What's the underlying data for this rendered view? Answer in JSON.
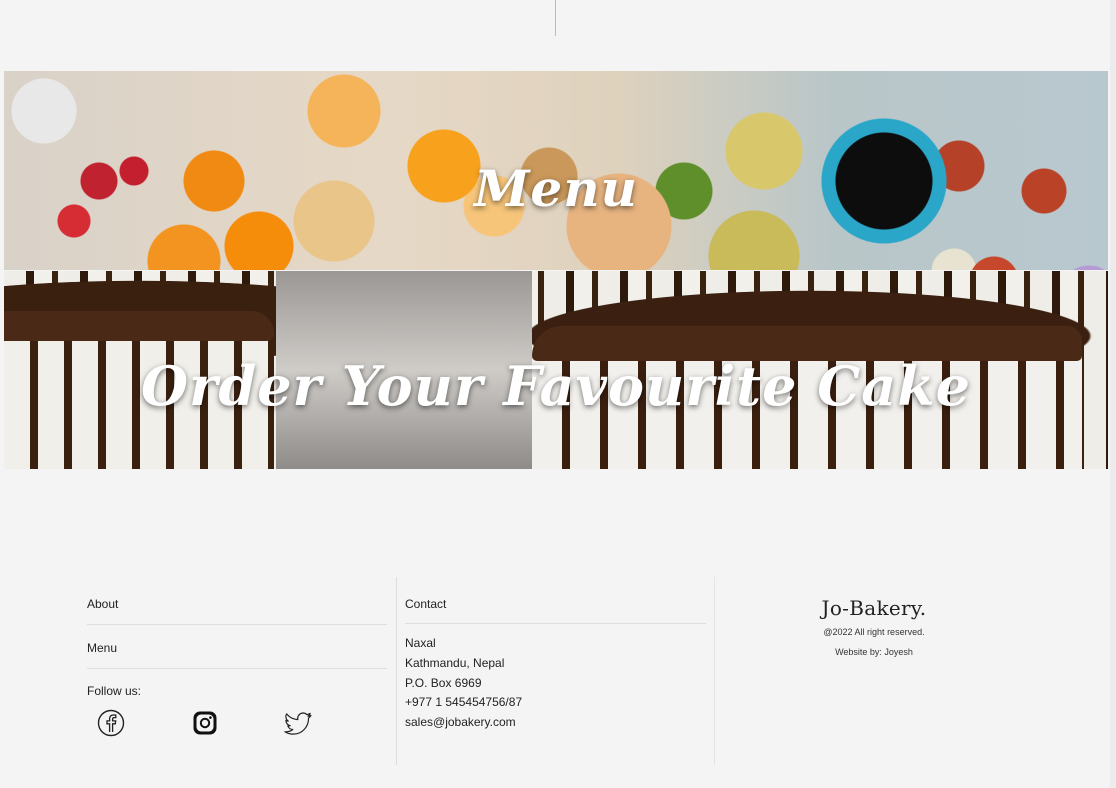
{
  "banners": {
    "menu_title": "Menu",
    "order_title": "Order Your Favourite Cake"
  },
  "footer": {
    "links": [
      {
        "label": "About"
      },
      {
        "label": "Menu"
      }
    ],
    "follow_label": "Follow us:",
    "social_icons": [
      "facebook-icon",
      "instagram-icon",
      "twitter-icon"
    ],
    "contact": {
      "heading": "Contact",
      "lines": [
        "Naxal",
        "Kathmandu, Nepal",
        "P.O. Box 6969",
        "+977 1 545454756/87"
      ],
      "email": "sales@jobakery.com"
    },
    "brand": {
      "name": "Jo-Bakery.",
      "copyright": "@2022 All right reserved.",
      "credit": "Website by: Joyesh"
    }
  }
}
